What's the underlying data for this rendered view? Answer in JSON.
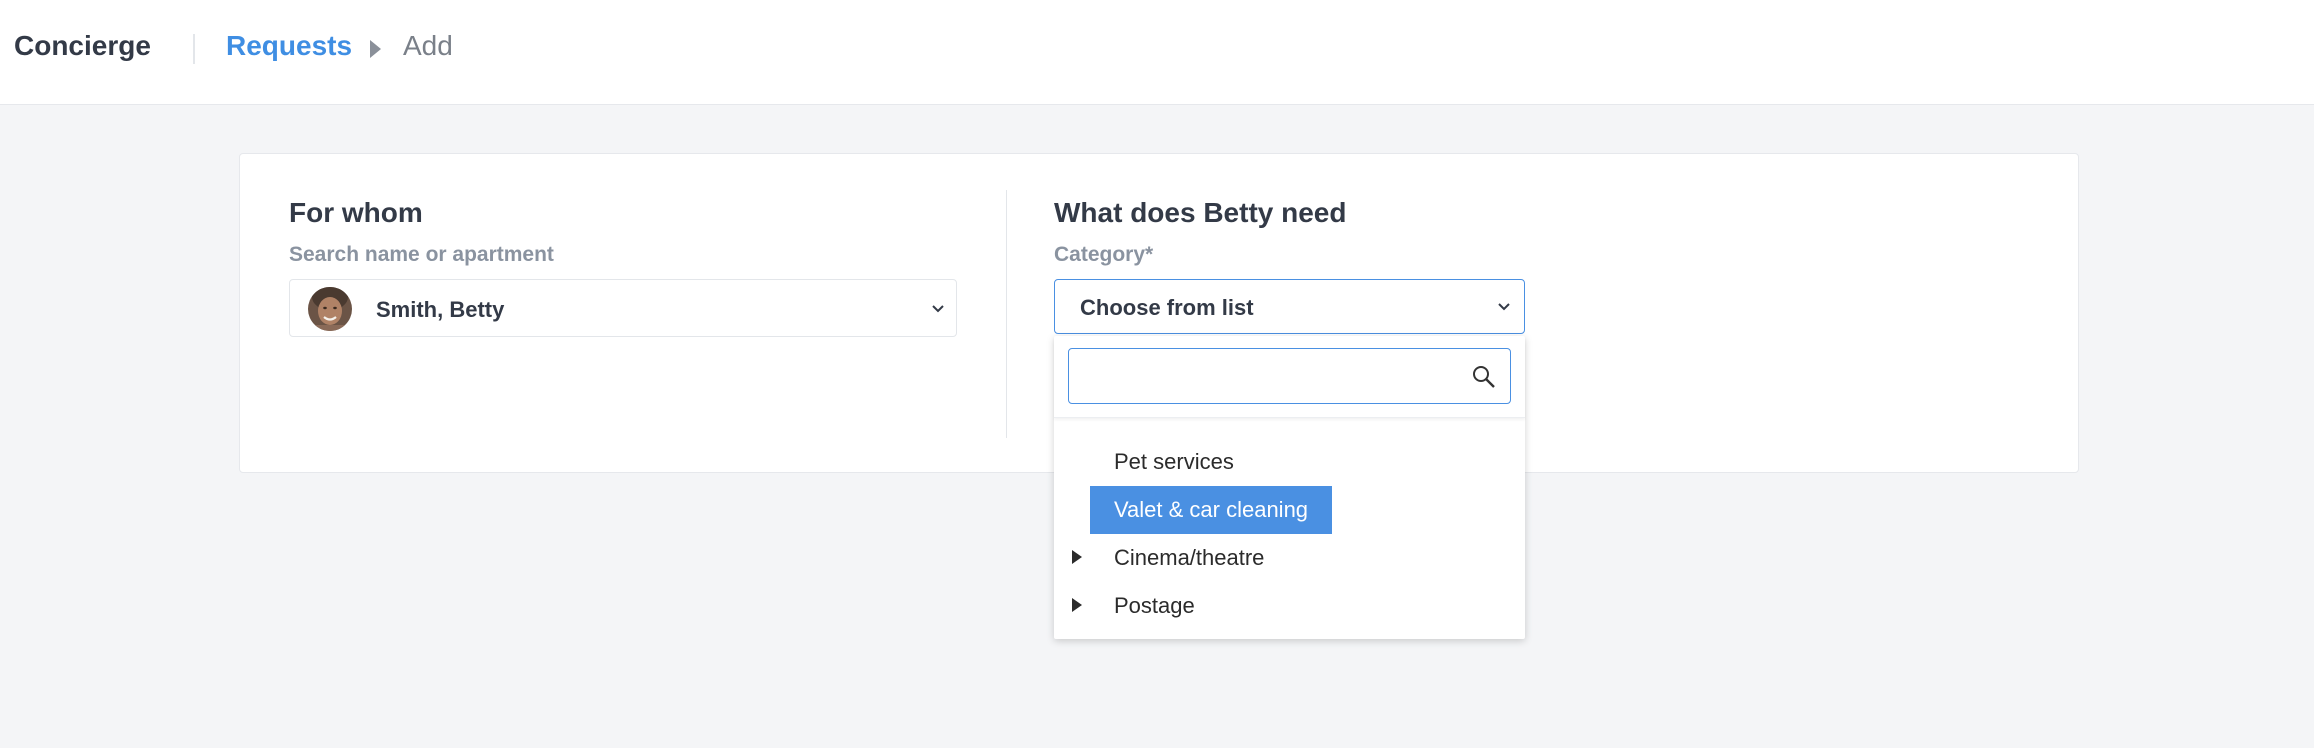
{
  "header": {
    "app_title": "Concierge",
    "breadcrumb": {
      "link": "Requests",
      "current": "Add"
    }
  },
  "for_whom": {
    "title": "For whom",
    "label": "Search name or apartment",
    "selected_person": "Smith, Betty"
  },
  "need": {
    "title": "What does Betty need",
    "category_label": "Category*",
    "category_value": "Choose from list"
  },
  "dropdown": {
    "search_value": "",
    "options": [
      {
        "label": "Pet services",
        "selected": false,
        "expandable": false
      },
      {
        "label": "Valet & car cleaning",
        "selected": true,
        "expandable": false
      },
      {
        "label": "Cinema/theatre",
        "selected": false,
        "expandable": true
      },
      {
        "label": "Postage",
        "selected": false,
        "expandable": true
      }
    ]
  },
  "colors": {
    "accent": "#4a90e2",
    "link": "#3f8ee3",
    "background": "#f4f5f7"
  }
}
